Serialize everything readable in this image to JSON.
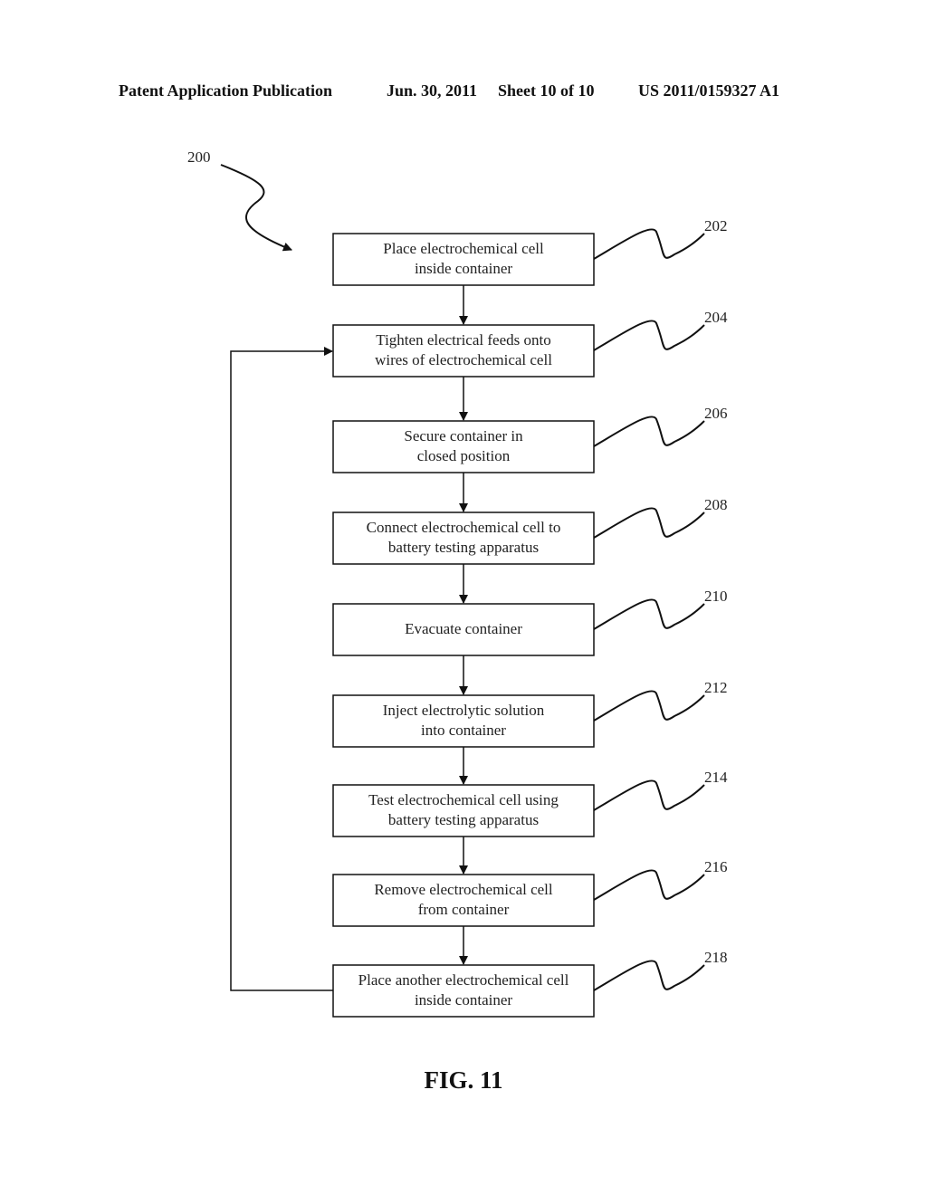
{
  "header": {
    "publication": "Patent Application Publication",
    "date": "Jun. 30, 2011",
    "sheet": "Sheet 10 of 10",
    "number": "US 2011/0159327 A1"
  },
  "diagram": {
    "ref": "200",
    "figure": "FIG. 11",
    "steps": [
      {
        "ref": "202",
        "line1": "Place electrochemical cell",
        "line2": "inside container"
      },
      {
        "ref": "204",
        "line1": "Tighten electrical feeds onto",
        "line2": "wires of electrochemical cell"
      },
      {
        "ref": "206",
        "line1": "Secure container in",
        "line2": "closed position"
      },
      {
        "ref": "208",
        "line1": "Connect electrochemical cell to",
        "line2": "battery testing apparatus"
      },
      {
        "ref": "210",
        "line1": "Evacuate container",
        "line2": ""
      },
      {
        "ref": "212",
        "line1": "Inject electrolytic solution",
        "line2": "into container"
      },
      {
        "ref": "214",
        "line1": "Test electrochemical cell using",
        "line2": "battery testing apparatus"
      },
      {
        "ref": "216",
        "line1": "Remove electrochemical cell",
        "line2": "from container"
      },
      {
        "ref": "218",
        "line1": "Place another electrochemical cell",
        "line2": "inside container"
      }
    ],
    "loop": {
      "from": "218",
      "to": "204"
    }
  }
}
